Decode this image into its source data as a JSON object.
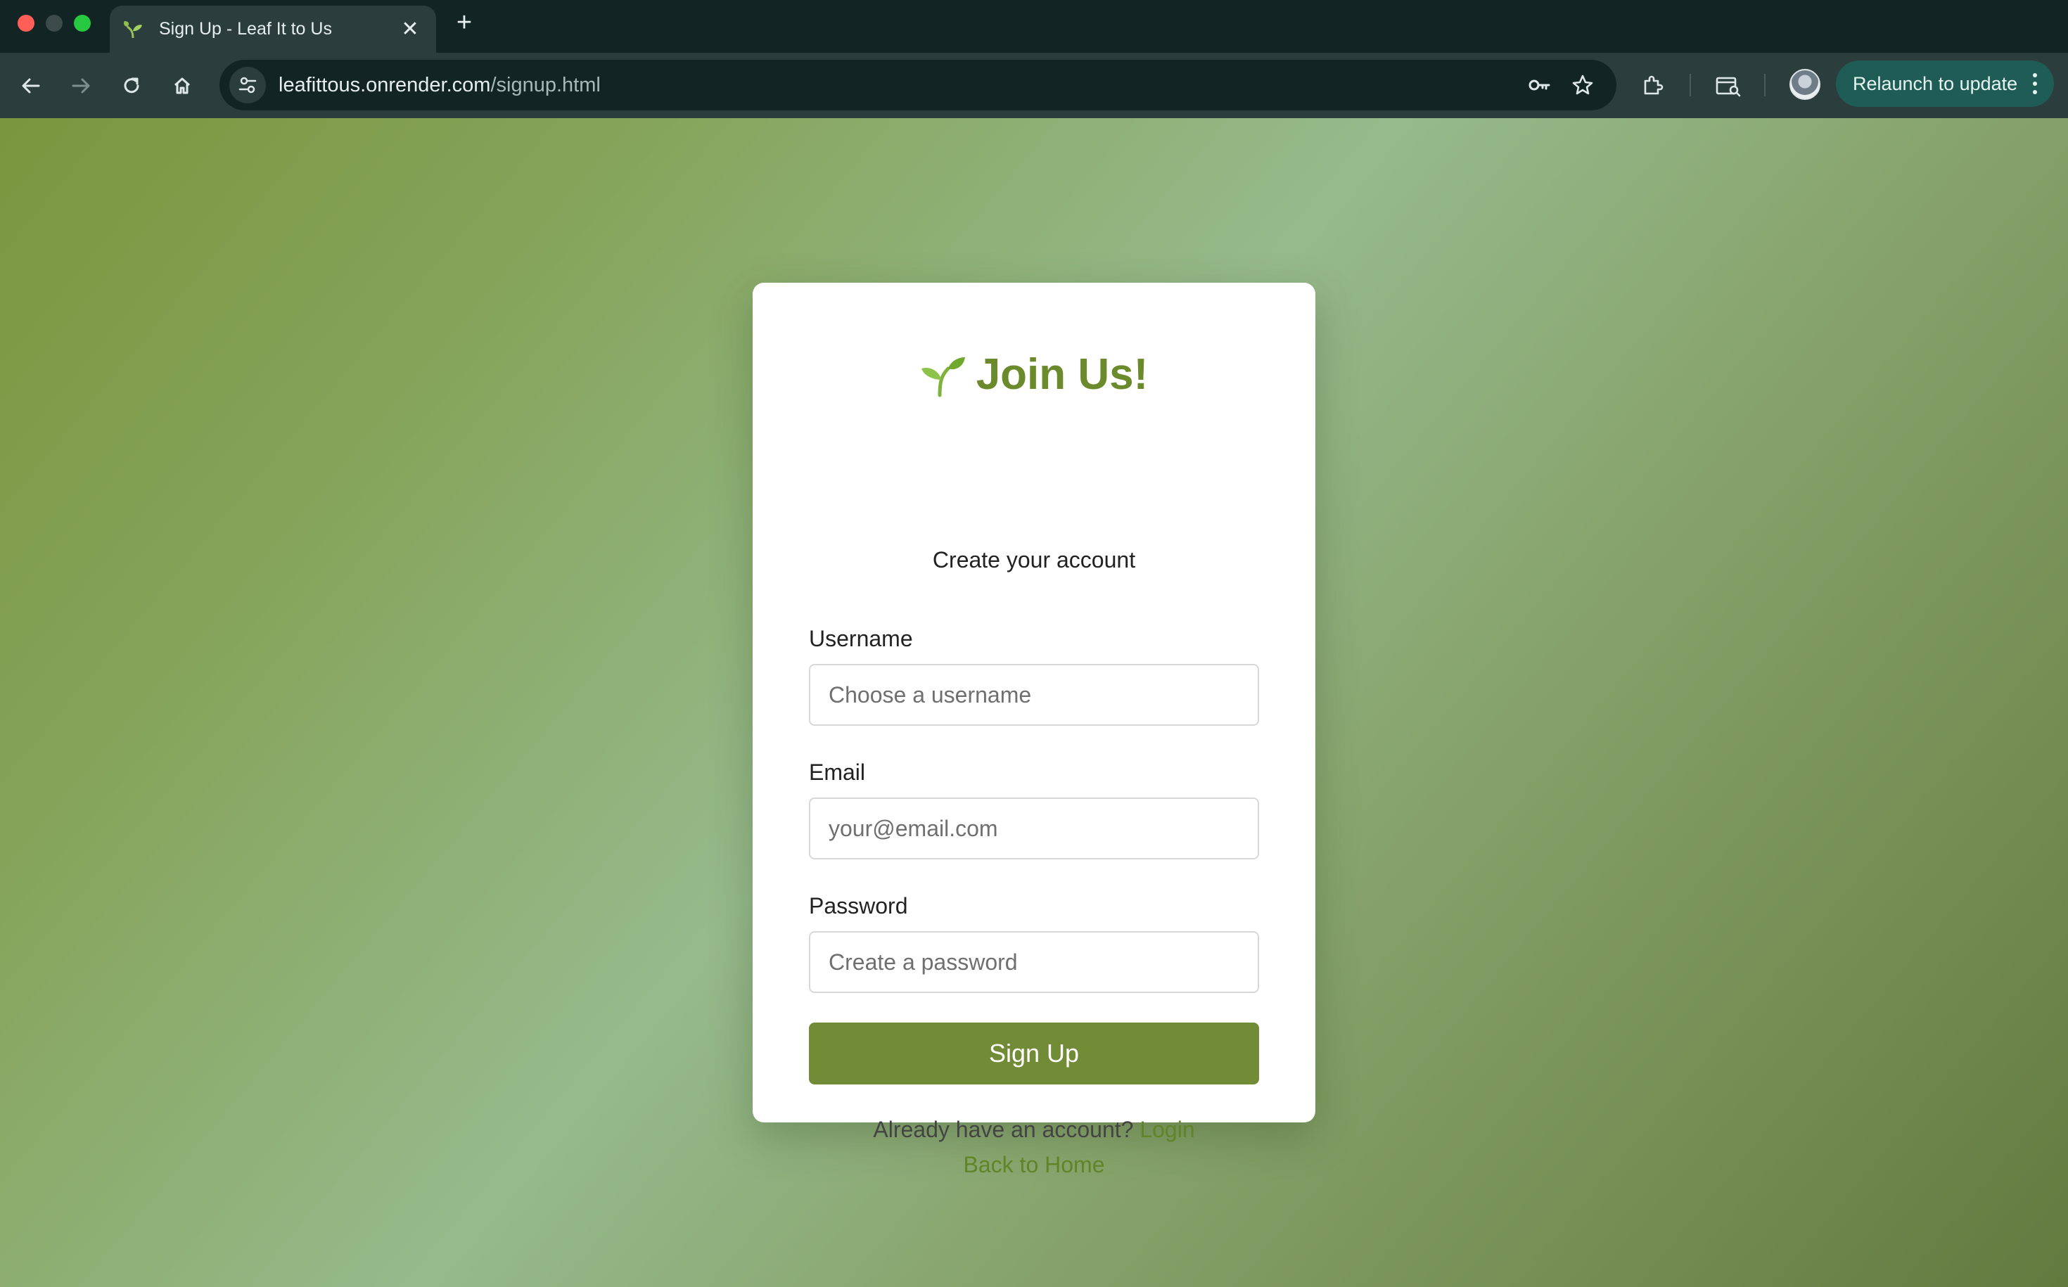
{
  "browser": {
    "tab": {
      "title": "Sign Up - Leaf It to Us",
      "close_glyph": "✕"
    },
    "new_tab_glyph": "+",
    "url": {
      "host": "leafittous.onrender.com",
      "path": "/signup.html"
    },
    "relaunch_label": "Relaunch to update"
  },
  "page": {
    "title": "Join Us!",
    "subtitle": "Create your account",
    "fields": {
      "username": {
        "label": "Username",
        "placeholder": "Choose a username"
      },
      "email": {
        "label": "Email",
        "placeholder": "your@email.com"
      },
      "password": {
        "label": "Password",
        "placeholder": "Create a password"
      }
    },
    "submit_label": "Sign Up",
    "login_prompt": "Already have an account?",
    "login_link": "Login",
    "home_link": "Back to Home"
  },
  "colors": {
    "accent": "#6b8a2c",
    "button": "#718b37",
    "link": "#5f8527",
    "chrome_dark": "#122424",
    "chrome_toolbar": "#2b3d3d"
  },
  "icons": [
    "sprout-icon",
    "back-arrow-icon",
    "forward-arrow-icon",
    "reload-icon",
    "home-icon",
    "site-settings-icon",
    "key-icon",
    "star-icon",
    "extensions-icon",
    "reading-mode-icon",
    "more-vert-icon"
  ]
}
